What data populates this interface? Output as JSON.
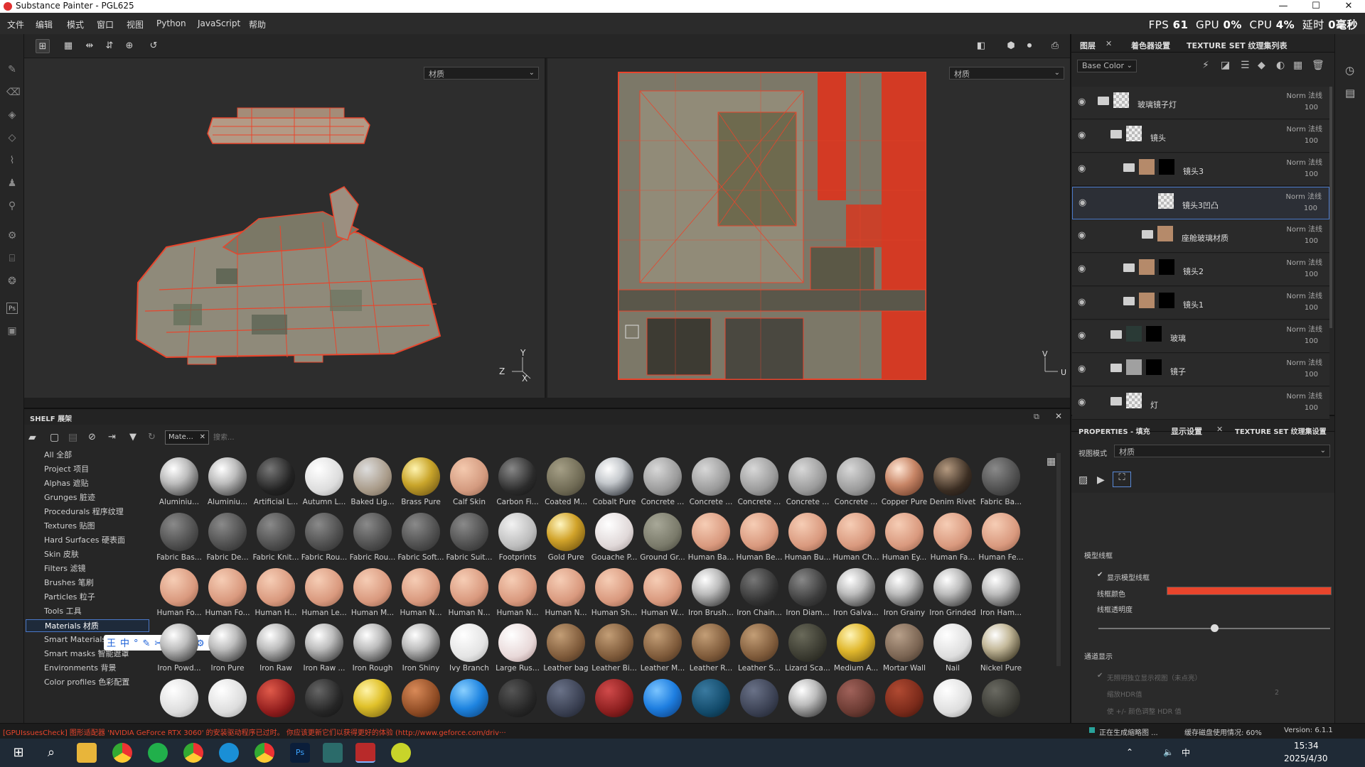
{
  "window": {
    "title": "Substance Painter - PGL625",
    "min": "—",
    "max": "☐",
    "close": "✕"
  },
  "menu": [
    "文件",
    "编辑",
    "模式",
    "窗口",
    "视图",
    "Python",
    "JavaScript",
    "帮助"
  ],
  "stats": {
    "fps_label": "FPS",
    "fps": "61",
    "gpu_label": "GPU",
    "gpu": "0%",
    "cpu_label": "CPU",
    "cpu": "4%",
    "latency_label": "延时",
    "latency": "0毫秒"
  },
  "viewport": {
    "left_dropdown": "材质",
    "right_dropdown": "材质",
    "axis_3d": {
      "y": "Y",
      "z": "Z",
      "x": "X"
    },
    "axis_uv": {
      "v": "V",
      "u": "U"
    }
  },
  "layers_panel": {
    "tabs": [
      "图层",
      "着色器设置",
      "TEXTURE SET 纹理集列表"
    ],
    "channel": "Base Color",
    "items": [
      {
        "name": "玻璃镜子灯",
        "blend": "Norm 法线",
        "opacity": "100",
        "thumb": "checker"
      },
      {
        "name": "镜头",
        "blend": "Norm 法线",
        "opacity": "100",
        "thumb": "checker"
      },
      {
        "name": "镜头3",
        "blend": "Norm 法线",
        "opacity": "100",
        "thumb": "tan"
      },
      {
        "name": "镜头3凹凸",
        "blend": "Norm 法线",
        "opacity": "100",
        "thumb": "checker"
      },
      {
        "name": "座舱玻璃材质",
        "blend": "Norm 法线",
        "opacity": "100",
        "thumb": "tan"
      },
      {
        "name": "镜头2",
        "blend": "Norm 法线",
        "opacity": "100",
        "thumb": "tan"
      },
      {
        "name": "镜头1",
        "blend": "Norm 法线",
        "opacity": "100",
        "thumb": "tan"
      },
      {
        "name": "玻璃",
        "blend": "Norm 法线",
        "opacity": "100",
        "thumb": "dark"
      },
      {
        "name": "镜子",
        "blend": "Norm 法线",
        "opacity": "100",
        "thumb": "grey"
      },
      {
        "name": "灯",
        "blend": "Norm 法线",
        "opacity": "100",
        "thumb": "checker"
      }
    ]
  },
  "props_panel": {
    "tabs": [
      "PROPERTIES - 填充",
      "显示设置",
      "TEXTURE SET 纹理集设置"
    ],
    "view_mode_label": "视图模式",
    "view_mode": "材质",
    "section_wire": "模型线框",
    "show_wire": "显示模型线框",
    "wire_color": "线框颜色",
    "wire_opacity": "线框透明度",
    "section_pass": "通道显示",
    "pass_opt1": "无照明独立显示视图（未点亮）",
    "pass_opt2": "缩放HDR值",
    "pass_val": "2",
    "pass_opt3": "使 +/- 颜色调整 HDR 值",
    "wire_opacity_value": 0.5,
    "wire_color_hex": "#e8452c"
  },
  "shelf": {
    "title": "SHELF 展架",
    "filter_tag": "Mate…",
    "search_placeholder": "搜索...",
    "tree": [
      "All 全部",
      "Project 项目",
      "Alphas 遮贴",
      "Grunges 脏迹",
      "Procedurals 程序纹理",
      "Textures 贴图",
      "Hard Surfaces 硬表面",
      "Skin 皮肤",
      "Filters 滤镜",
      "Brushes 笔刷",
      "Particles 粒子",
      "Tools 工具",
      "Materials 材质",
      "Smart Materials",
      "Smart masks 智能遮罩",
      "Environments 背景",
      "Color profiles 色彩配置"
    ],
    "selected": "Materials 材质",
    "rows": [
      [
        "Aluminiu...",
        "Aluminiu...",
        "Artificial L...",
        "Autumn L...",
        "Baked Lig...",
        "Brass Pure",
        "Calf Skin",
        "Carbon Fi...",
        "Coated M...",
        "Cobalt Pure",
        "Concrete ...",
        "Concrete ...",
        "Concrete ...",
        "Concrete ...",
        "Concrete ...",
        "Copper Pure",
        "Denim Rivet",
        "Fabric Ba..."
      ],
      [
        "Fabric Bas...",
        "Fabric De...",
        "Fabric Knit...",
        "Fabric Rou...",
        "Fabric Rou...",
        "Fabric Soft...",
        "Fabric Suit...",
        "Footprints",
        "Gold Pure",
        "Gouache P...",
        "Ground Gr...",
        "Human Ba...",
        "Human Be...",
        "Human Bu...",
        "Human Ch...",
        "Human Ey...",
        "Human Fa...",
        "Human Fe..."
      ],
      [
        "Human Fo...",
        "Human Fo...",
        "Human H...",
        "Human Le...",
        "Human M...",
        "Human N...",
        "Human N...",
        "Human N...",
        "Human N...",
        "Human Sh...",
        "Human W...",
        "Iron Brush...",
        "Iron Chain...",
        "Iron Diam...",
        "Iron Galva...",
        "Iron Grainy",
        "Iron Grinded",
        "Iron Ham..."
      ],
      [
        "Iron Powd...",
        "Iron Pure",
        "Iron Raw",
        "Iron Raw ...",
        "Iron Rough",
        "Iron Shiny",
        "Ivy Branch",
        "Large Rus...",
        "Leather bag",
        "Leather Bi...",
        "Leather M...",
        "Leather R...",
        "Leather S...",
        "Lizard Sca...",
        "Medium A...",
        "Mortar Wall",
        "Nail",
        "Nickel Pure"
      ],
      [
        "",
        "",
        "",
        "",
        "",
        "",
        "",
        "",
        "",
        "",
        "",
        "",
        "",
        "",
        "",
        "",
        "",
        ""
      ]
    ]
  },
  "status": {
    "left": "[GPUIssuesCheck] 图形适配器 'NVIDIA GeForce RTX 3060' 的安装驱动程序已过时。 你应该更新它们以获得更好的体验 (http://www.geforce.com/driv···",
    "gen": "正在生成缩略图 ...",
    "cache": "缓存磁盘使用情况:  60%",
    "version": "Version: 6.1.1"
  },
  "taskbar": {
    "time": "15:34",
    "date": "2025/4/30",
    "lang": "中"
  }
}
